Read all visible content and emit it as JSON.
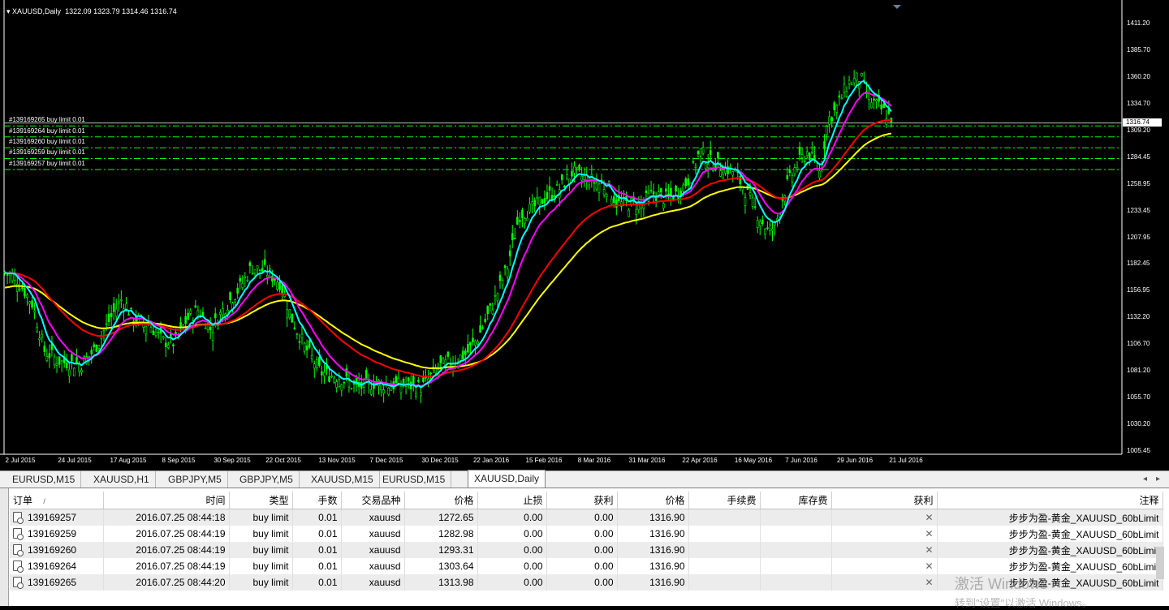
{
  "chart": {
    "symbol_title": "XAUUSD,Daily",
    "ohlc": "1322.09 1323.79 1314.46 1316.74",
    "current_price": "1316.74",
    "price_ticks": [
      "1411.20",
      "1385.70",
      "1360.20",
      "1334.70",
      "1309.20",
      "1284.45",
      "1258.95",
      "1233.45",
      "1207.95",
      "1182.45",
      "1156.95",
      "1132.20",
      "1106.70",
      "1081.20",
      "1055.70",
      "1030.20",
      "1005.45"
    ],
    "date_ticks": [
      "2 Jul 2015",
      "24 Jul 2015",
      "17 Aug 2015",
      "8 Sep 2015",
      "30 Sep 2015",
      "22 Oct 2015",
      "13 Nov 2015",
      "7 Dec 2015",
      "30 Dec 2015",
      "22 Jan 2016",
      "15 Feb 2016",
      "8 Mar 2016",
      "31 Mar 2016",
      "22 Apr 2016",
      "16 May 2016",
      "7 Jun 2016",
      "29 Jun 2016",
      "21 Jul 2016"
    ],
    "pending_orders": [
      "#139169265 buy limit 0.01",
      "#139169264 buy limit 0.01",
      "#139169260 buy limit 0.01",
      "#139169259 buy limit 0.01",
      "#139169257 buy limit 0.01"
    ],
    "colors": {
      "background": "#000000",
      "candles": "#00ff00",
      "ma_fast": "#00ffff",
      "ma_mid": "#ff00ff",
      "ma_slow": "#ff0000",
      "ma_slowest": "#ffff00",
      "order_lines": "#00ff00"
    }
  },
  "tabs": [
    "EURUSD,M15",
    "XAUUSD,H1",
    "GBPJPY,M5",
    "GBPJPY,M5",
    "XAUUSD,M15",
    "EURUSD,M15",
    "XAUUSD,Daily"
  ],
  "active_tab": "XAUUSD,Daily",
  "orders_table": {
    "headers": [
      "订单",
      "时间",
      "类型",
      "手数",
      "交易品种",
      "价格",
      "止损",
      "获利",
      "价格",
      "手续费",
      "库存费",
      "获利",
      "注释"
    ],
    "sort_marker": "/",
    "rows": [
      {
        "order": "139169257",
        "time": "2016.07.25 08:44:18",
        "type": "buy limit",
        "lots": "0.01",
        "symbol": "xauusd",
        "price": "1272.65",
        "sl": "0.00",
        "tp": "0.00",
        "cur_price": "1316.90",
        "commission": "",
        "swap": "",
        "profit": "",
        "comment": "步步为盈-黄金_XAUUSD_60bLimit"
      },
      {
        "order": "139169259",
        "time": "2016.07.25 08:44:19",
        "type": "buy limit",
        "lots": "0.01",
        "symbol": "xauusd",
        "price": "1282.98",
        "sl": "0.00",
        "tp": "0.00",
        "cur_price": "1316.90",
        "commission": "",
        "swap": "",
        "profit": "",
        "comment": "步步为盈-黄金_XAUUSD_60bLimit"
      },
      {
        "order": "139169260",
        "time": "2016.07.25 08:44:19",
        "type": "buy limit",
        "lots": "0.01",
        "symbol": "xauusd",
        "price": "1293.31",
        "sl": "0.00",
        "tp": "0.00",
        "cur_price": "1316.90",
        "commission": "",
        "swap": "",
        "profit": "",
        "comment": "步步为盈-黄金_XAUUSD_60bLimit"
      },
      {
        "order": "139169264",
        "time": "2016.07.25 08:44:19",
        "type": "buy limit",
        "lots": "0.01",
        "symbol": "xauusd",
        "price": "1303.64",
        "sl": "0.00",
        "tp": "0.00",
        "cur_price": "1316.90",
        "commission": "",
        "swap": "",
        "profit": "",
        "comment": "步步为盈-黄金_XAUUSD_60bLimit"
      },
      {
        "order": "139169265",
        "time": "2016.07.25 08:44:20",
        "type": "buy limit",
        "lots": "0.01",
        "symbol": "xauusd",
        "price": "1313.98",
        "sl": "0.00",
        "tp": "0.00",
        "cur_price": "1316.90",
        "commission": "",
        "swap": "",
        "profit": "",
        "comment": "步步为盈-黄金_XAUUSD_60bLimit"
      }
    ],
    "close_icon": "close-x-icon"
  },
  "watermark": {
    "line1": "激活 Windows",
    "line2": "转到\"设置\"以激活 Windows。"
  }
}
